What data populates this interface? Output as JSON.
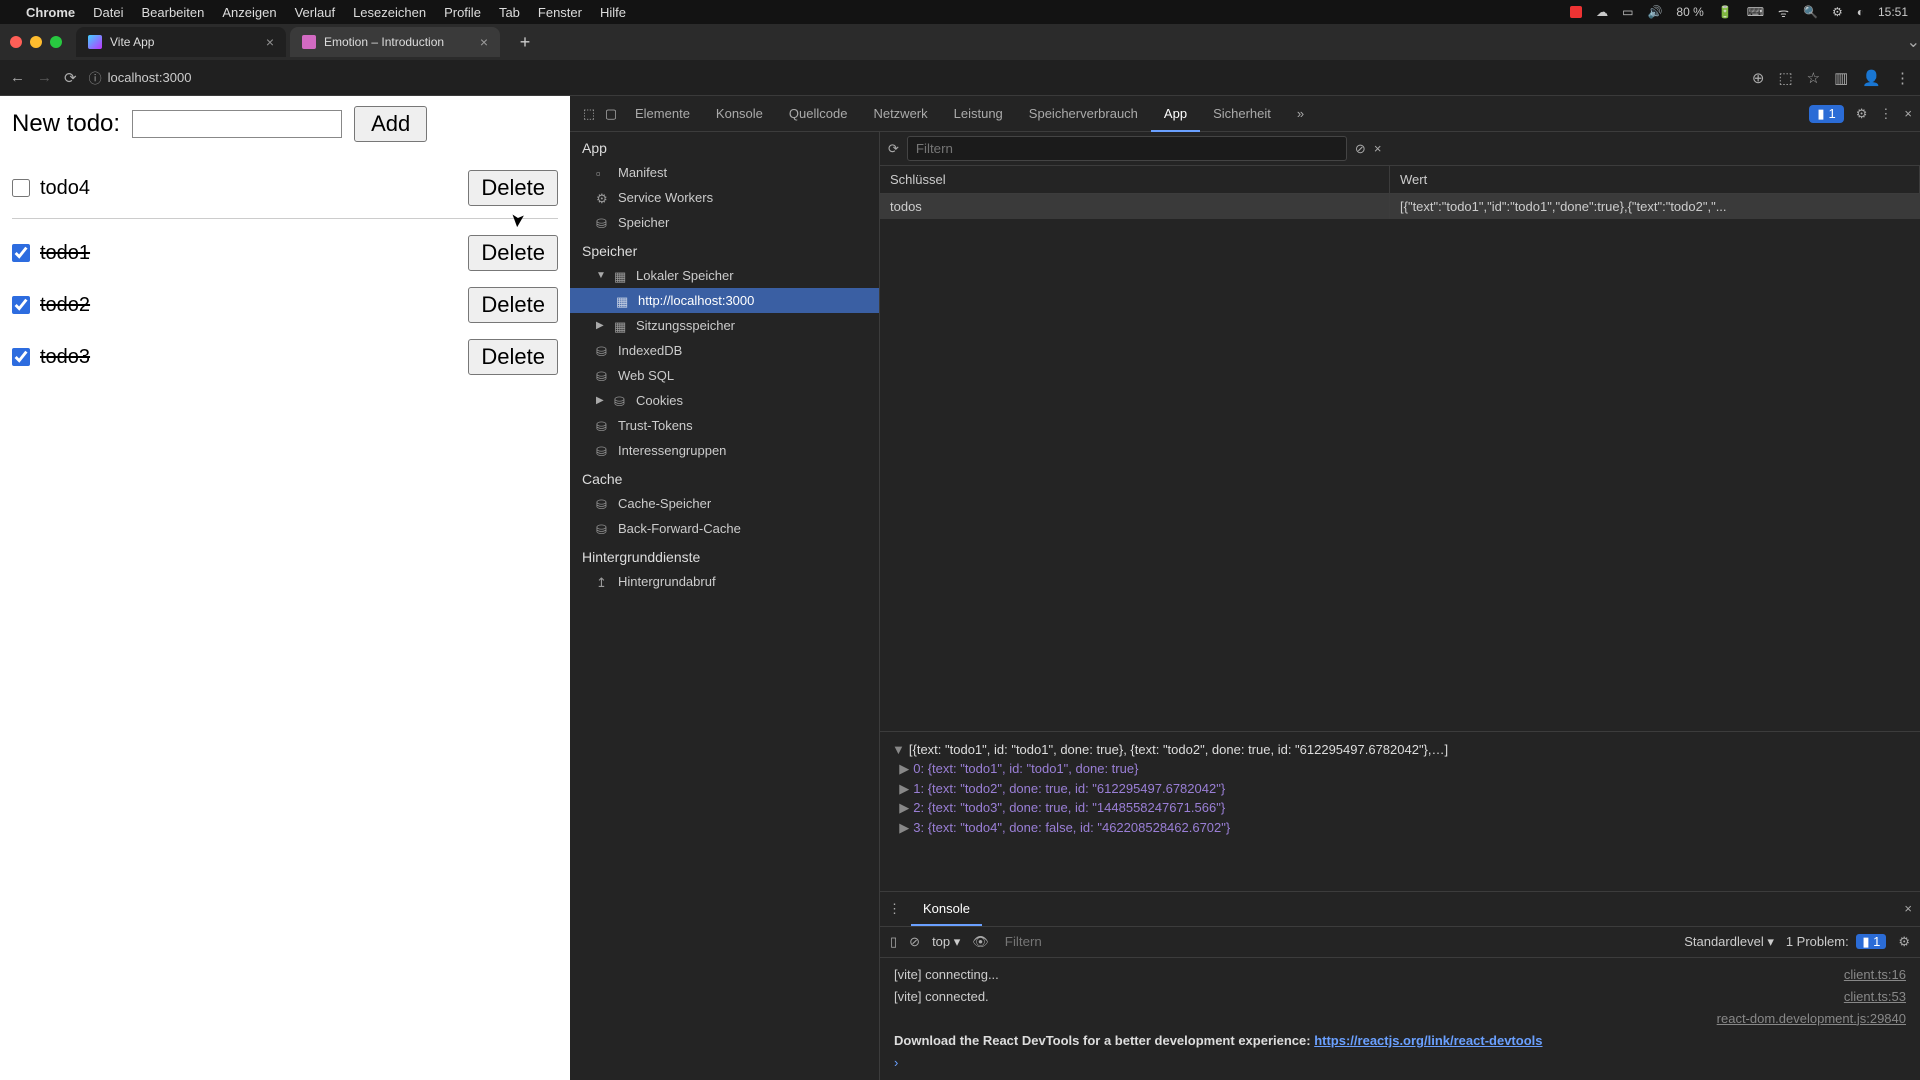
{
  "menubar": {
    "app": "Chrome",
    "items": [
      "Datei",
      "Bearbeiten",
      "Anzeigen",
      "Verlauf",
      "Lesezeichen",
      "Profile",
      "Tab",
      "Fenster",
      "Hilfe"
    ],
    "battery": "80 %",
    "time": "15:51"
  },
  "tabs": [
    {
      "title": "Vite App",
      "active": true
    },
    {
      "title": "Emotion – Introduction",
      "active": false
    }
  ],
  "url": "localhost:3000",
  "todo_form": {
    "label": "New todo:",
    "add": "Add"
  },
  "todos": [
    {
      "text": "todo4",
      "done": false
    },
    {
      "text": "todo1",
      "done": true
    },
    {
      "text": "todo2",
      "done": true
    },
    {
      "text": "todo3",
      "done": true
    }
  ],
  "delete_label": "Delete",
  "devtools": {
    "tabs": [
      "Elemente",
      "Konsole",
      "Quellcode",
      "Netzwerk",
      "Leistung",
      "Speicherverbrauch",
      "App",
      "Sicherheit"
    ],
    "active_tab": "App",
    "issues": "1",
    "filter_placeholder": "Filtern",
    "sidebar": {
      "app_section": "App",
      "app_items": [
        "Manifest",
        "Service Workers",
        "Speicher"
      ],
      "storage_section": "Speicher",
      "local_storage": "Lokaler Speicher",
      "local_origin": "http://localhost:3000",
      "session_storage": "Sitzungsspeicher",
      "indexeddb": "IndexedDB",
      "websql": "Web SQL",
      "cookies": "Cookies",
      "trust": "Trust-Tokens",
      "interest": "Interessengruppen",
      "cache_section": "Cache",
      "cache_storage": "Cache-Speicher",
      "bfcache": "Back-Forward-Cache",
      "bg_section": "Hintergrunddienste",
      "bg_fetch": "Hintergrundabruf"
    },
    "table": {
      "key_header": "Schlüssel",
      "value_header": "Wert",
      "row_key": "todos",
      "row_value": "[{\"text\":\"todo1\",\"id\":\"todo1\",\"done\":true},{\"text\":\"todo2\",\"..."
    },
    "preview": {
      "summary": "[{text: \"todo1\", id: \"todo1\", done: true}, {text: \"todo2\", done: true, id: \"612295497.6782042\"},…]",
      "items": [
        "0: {text: \"todo1\", id: \"todo1\", done: true}",
        "1: {text: \"todo2\", done: true, id: \"612295497.6782042\"}",
        "2: {text: \"todo3\", done: true, id: \"1448558247671.566\"}",
        "3: {text: \"todo4\", done: false, id: \"462208528462.6702\"}"
      ]
    }
  },
  "console": {
    "tab": "Konsole",
    "context": "top",
    "filter": "Filtern",
    "level": "Standardlevel",
    "problems": "1 Problem:",
    "problems_count": "1",
    "logs": [
      {
        "msg": "[vite] connecting...",
        "src": "client.ts:16"
      },
      {
        "msg": "[vite] connected.",
        "src": "client.ts:53"
      },
      {
        "msg": "",
        "src": "react-dom.development.js:29840"
      },
      {
        "msg": "Download the React DevTools for a better development experience: ",
        "link": "https://reactjs.org/link/react-devtools",
        "src": ""
      }
    ]
  }
}
